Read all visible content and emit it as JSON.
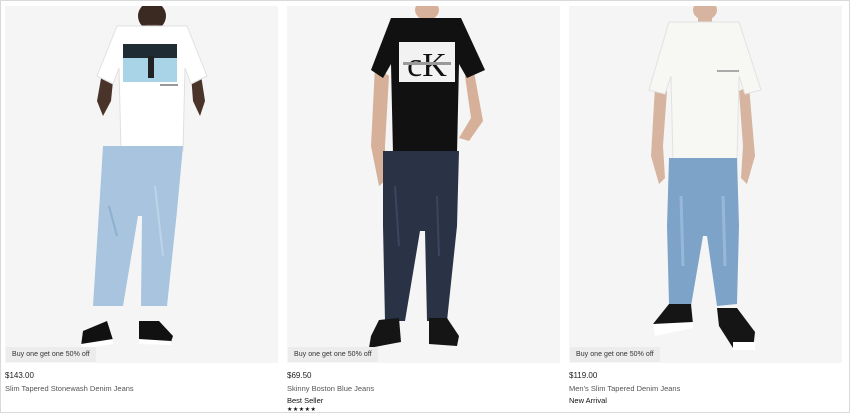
{
  "products": [
    {
      "promo": "Buy one get one 50% off",
      "price": "$143.00",
      "name": "Slim Tapered Stonewash Denim Jeans",
      "tag": "",
      "rating_stars": "",
      "shirt_color": "#ffffff",
      "jeans_color": "#a8c4de"
    },
    {
      "promo": "Buy one get one 50% off",
      "price": "$69.50",
      "name": "Skinny Boston Blue Jeans",
      "tag": "Best Seller",
      "rating_stars": "★★★★★",
      "shirt_color": "#111111",
      "jeans_color": "#2a3346"
    },
    {
      "promo": "Buy one get one 50% off",
      "price": "$119.00",
      "name": "Men's Slim Tapered Denim Jeans",
      "tag": "New Arrival",
      "rating_stars": "",
      "shirt_color": "#f7f7f4",
      "jeans_color": "#7ea3c9"
    }
  ]
}
